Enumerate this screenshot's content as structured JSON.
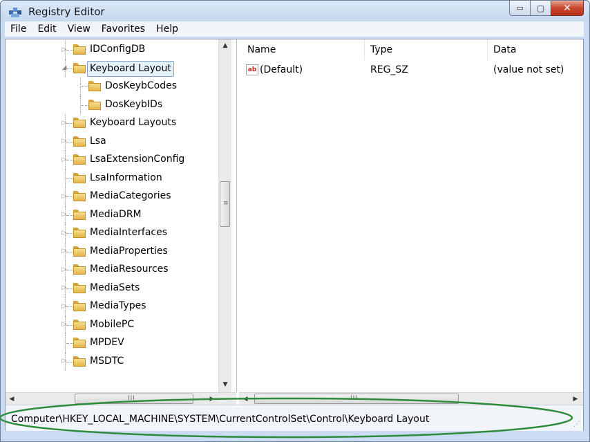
{
  "window": {
    "title": "Registry Editor",
    "min_glyph": "▭",
    "max_glyph": "▢",
    "close_glyph": "✕"
  },
  "menu": [
    "File",
    "Edit",
    "View",
    "Favorites",
    "Help"
  ],
  "tree": {
    "items": [
      {
        "label": "IDConfigDB",
        "expander": "▷",
        "level": 0
      },
      {
        "label": "Keyboard Layout",
        "expander": "◢",
        "level": 0,
        "selected": true
      },
      {
        "label": "DosKeybCodes",
        "expander": "",
        "level": 1
      },
      {
        "label": "DosKeybIDs",
        "expander": "",
        "level": 1
      },
      {
        "label": "Keyboard Layouts",
        "expander": "▷",
        "level": 0
      },
      {
        "label": "Lsa",
        "expander": "▷",
        "level": 0
      },
      {
        "label": "LsaExtensionConfig",
        "expander": "▷",
        "level": 0
      },
      {
        "label": "LsaInformation",
        "expander": "",
        "level": 0
      },
      {
        "label": "MediaCategories",
        "expander": "▷",
        "level": 0
      },
      {
        "label": "MediaDRM",
        "expander": "▷",
        "level": 0
      },
      {
        "label": "MediaInterfaces",
        "expander": "▷",
        "level": 0
      },
      {
        "label": "MediaProperties",
        "expander": "▷",
        "level": 0
      },
      {
        "label": "MediaResources",
        "expander": "▷",
        "level": 0
      },
      {
        "label": "MediaSets",
        "expander": "▷",
        "level": 0
      },
      {
        "label": "MediaTypes",
        "expander": "▷",
        "level": 0
      },
      {
        "label": "MobilePC",
        "expander": "▷",
        "level": 0
      },
      {
        "label": "MPDEV",
        "expander": "",
        "level": 0
      },
      {
        "label": "MSDTC",
        "expander": "▷",
        "level": 0
      }
    ],
    "scroll_up": "▲",
    "scroll_down": "▼",
    "grip": "≡"
  },
  "list": {
    "columns": [
      "Name",
      "Type",
      "Data"
    ],
    "rows": [
      {
        "name": "(Default)",
        "type": "REG_SZ",
        "data": "(value not set)",
        "icon": "ab"
      }
    ]
  },
  "hscroll": {
    "left": "◀",
    "right": "▶",
    "grip": "III"
  },
  "status": {
    "path": "Computer\\HKEY_LOCAL_MACHINE\\SYSTEM\\CurrentControlSet\\Control\\Keyboard Layout",
    "grip": "⋰"
  },
  "colors": {
    "highlight_ellipse": "#2e8b3a",
    "selection_border": "#7da2ce",
    "selection_bg": "#e5f1fb"
  }
}
